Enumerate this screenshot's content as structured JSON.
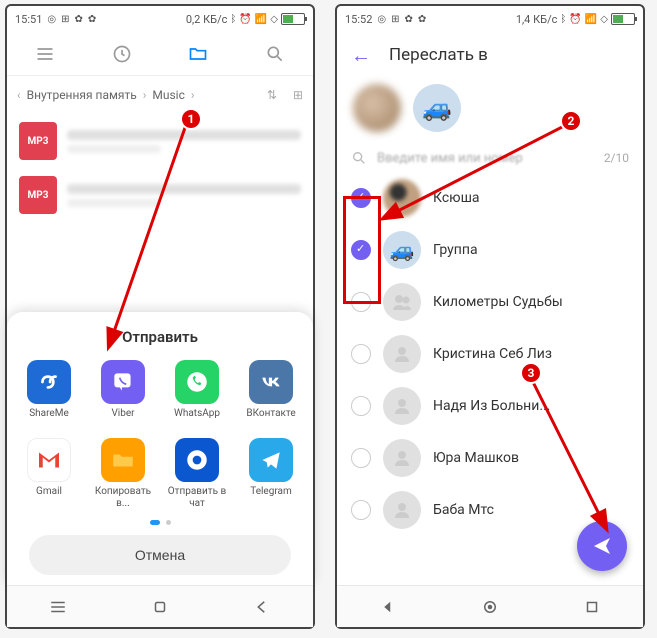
{
  "left": {
    "status": {
      "time": "15:51",
      "net": "0,2 КБ/с"
    },
    "breadcrumb": {
      "root": "Внутренняя память",
      "folder": "Music"
    },
    "file_badge": "MP3",
    "share": {
      "title": "Отправить",
      "apps": [
        {
          "label": "ShareMe"
        },
        {
          "label": "Viber"
        },
        {
          "label": "WhatsApp"
        },
        {
          "label": "ВКонтакте"
        },
        {
          "label": "Gmail"
        },
        {
          "label": "Копировать в..."
        },
        {
          "label": "Отправить в чат"
        },
        {
          "label": "Telegram"
        }
      ],
      "cancel": "Отмена"
    }
  },
  "right": {
    "status": {
      "time": "15:52",
      "net": "1,4 КБ/с"
    },
    "title": "Переслать в",
    "search": {
      "placeholder": "Введите имя или номер",
      "count": "2/10"
    },
    "contacts": [
      {
        "name": "Ксюша",
        "selected": true
      },
      {
        "name": "Группа",
        "selected": true
      },
      {
        "name": "Километры Судьбы",
        "selected": false
      },
      {
        "name": "Кристина Себ Лиз",
        "selected": false
      },
      {
        "name": "Надя Из Больни...",
        "selected": false
      },
      {
        "name": "Юра Машков",
        "selected": false
      },
      {
        "name": "Баба Мтс",
        "selected": false
      }
    ]
  },
  "badges": {
    "b1": "1",
    "b2": "2",
    "b3": "3"
  }
}
